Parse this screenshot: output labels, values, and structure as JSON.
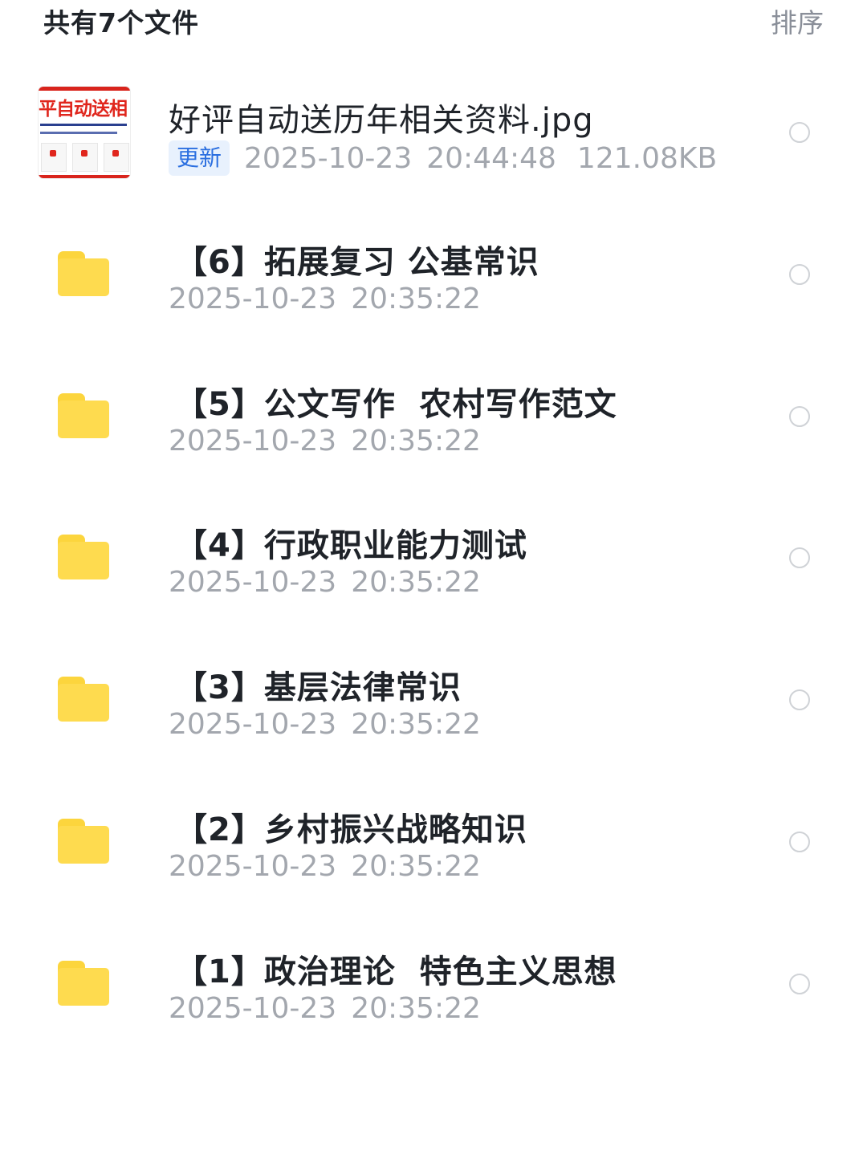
{
  "header": {
    "file_count": "共有7个文件",
    "sort_label": "排序"
  },
  "files": [
    {
      "type": "image",
      "name": "好评自动送历年相关资料.jpg",
      "badge": "更新",
      "date": "2025-10-23",
      "time": "20:44:48",
      "size": "121.08KB",
      "thumb_text": "平自动送相"
    },
    {
      "type": "folder",
      "name": "【6】拓展复习 公基常识",
      "date": "2025-10-23",
      "time": "20:35:22"
    },
    {
      "type": "folder",
      "name": "【5】公文写作  农村写作范文",
      "date": "2025-10-23",
      "time": "20:35:22"
    },
    {
      "type": "folder",
      "name": "【4】行政职业能力测试",
      "date": "2025-10-23",
      "time": "20:35:22"
    },
    {
      "type": "folder",
      "name": "【3】基层法律常识",
      "date": "2025-10-23",
      "time": "20:35:22"
    },
    {
      "type": "folder",
      "name": "【2】乡村振兴战略知识",
      "date": "2025-10-23",
      "time": "20:35:22"
    },
    {
      "type": "folder",
      "name": "【1】政治理论  特色主义思想",
      "date": "2025-10-23",
      "time": "20:35:22"
    }
  ],
  "colors": {
    "folder": "#fedb4f",
    "badge_bg": "#e8f1fd",
    "badge_text": "#2b6fe0",
    "meta_text": "#a3a7ae"
  }
}
